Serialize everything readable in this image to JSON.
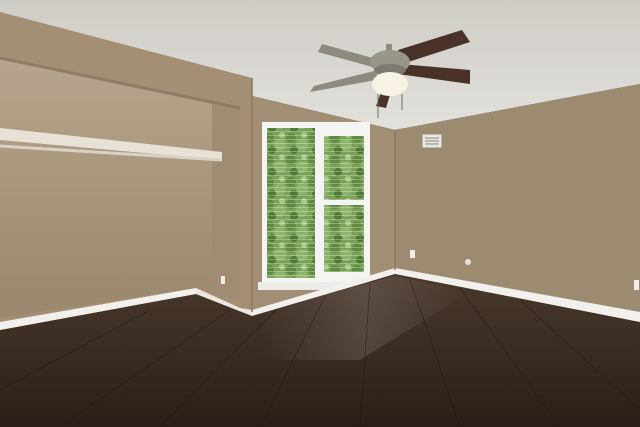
{
  "scene": {
    "subject": "empty-bedroom",
    "colors": {
      "ceiling": "#d9d6d0",
      "wall_back": "#a08d74",
      "wall_right": "#9c8a71",
      "wall_left": "#a28e74",
      "closet_interior": "#a8947a",
      "floor": "#3a2c22",
      "baseboard": "#f2f0ec",
      "window_frame": "#f4f4f2",
      "foliage": "#6f9a4f",
      "fan_blade": "#4a3228",
      "fan_body": "#8f8a80",
      "fan_light": "#f5f0e2"
    }
  }
}
